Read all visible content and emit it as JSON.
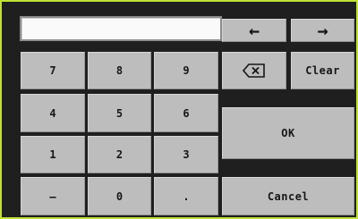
{
  "display": {
    "value": ""
  },
  "keys": {
    "left_arrow": "←",
    "right_arrow": "→",
    "d7": "7",
    "d8": "8",
    "d9": "9",
    "d4": "4",
    "d5": "5",
    "d6": "6",
    "d1": "1",
    "d2": "2",
    "d3": "3",
    "minus": "–",
    "d0": "0",
    "dot": ".",
    "clear": "Clear",
    "ok": "OK",
    "cancel": "Cancel"
  },
  "icons": {
    "backspace": "backspace-icon"
  },
  "colors": {
    "frame_border": "#bfe033",
    "background": "#1f1f1f",
    "key": "#bdbdbd",
    "display": "#fafafa"
  }
}
